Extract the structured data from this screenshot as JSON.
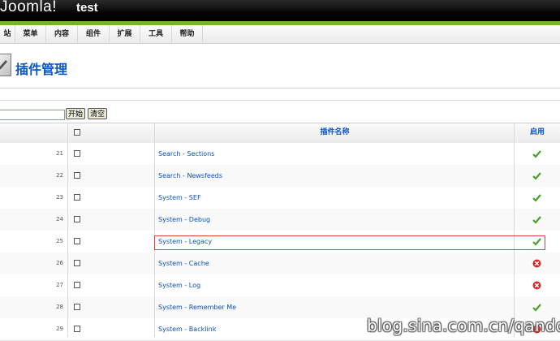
{
  "header": {
    "logo_text": "Joomla!",
    "site_title": "test"
  },
  "menu": {
    "items": [
      {
        "label": "站"
      },
      {
        "label": "菜单"
      },
      {
        "label": "内容"
      },
      {
        "label": "组件"
      },
      {
        "label": "扩展"
      },
      {
        "label": "工具"
      },
      {
        "label": "帮助"
      }
    ]
  },
  "toolbar": {
    "title": "插件管理"
  },
  "filter": {
    "value": "",
    "go_label": "开始",
    "reset_label": "清空"
  },
  "table": {
    "col_name": "插件名称",
    "col_enabled": "启用",
    "rows": [
      {
        "num": "21",
        "name": "Search - Sections",
        "enabled": true
      },
      {
        "num": "22",
        "name": "Search - Newsfeeds",
        "enabled": true
      },
      {
        "num": "23",
        "name": "System - SEF",
        "enabled": true
      },
      {
        "num": "24",
        "name": "System - Debug",
        "enabled": true
      },
      {
        "num": "25",
        "name": "System - Legacy",
        "enabled": true
      },
      {
        "num": "26",
        "name": "System - Cache",
        "enabled": false
      },
      {
        "num": "27",
        "name": "System - Log",
        "enabled": false
      },
      {
        "num": "28",
        "name": "System - Remember Me",
        "enabled": true
      },
      {
        "num": "29",
        "name": "System - Backlink",
        "enabled": false
      }
    ]
  },
  "colors": {
    "accent_green": "#73b332",
    "link_blue": "#0b55c4",
    "enabled_green": "#4aa02c",
    "disabled_red": "#d62b2b",
    "highlight_red": "#e04040"
  },
  "watermark": "blog.sina.com.cn/qandq"
}
